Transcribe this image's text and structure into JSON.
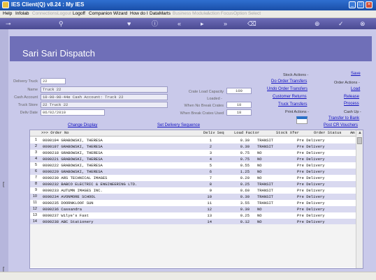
{
  "window": {
    "title": "IES Client(Q) v8.24 : My IES"
  },
  "menu": [
    "Help",
    "Infolab",
    "Connections",
    "Logout",
    "Logoff",
    "Companion",
    "Wizard",
    "How do I",
    "DataMarts",
    "Business Modules",
    "Action Focus",
    "Option Select"
  ],
  "menu_disabled": [
    2,
    3,
    9,
    10,
    11
  ],
  "page": {
    "title": "Sari Sari Dispatch"
  },
  "form": {
    "delivery_truck_label": "Delivery Truck",
    "delivery_truck": "22",
    "name_label": "Name",
    "name": "Truck 22",
    "cash_account_label": "Cash Account",
    "cash_account": "10-00-00-44e Cash Account: Truck 22",
    "truck_store_label": "Truck Store",
    "truck_store": "22 Truck 22",
    "deliv_date_label": "Deliv Date",
    "deliv_date": "06/02/2010",
    "crate_capacity_label": "Crate Load Capacity",
    "crate_capacity": "100",
    "loaded_label": "Loaded -",
    "no_break_label": "When No Break Crates",
    "no_break": "18",
    "break_label": "When Break Crates Used",
    "break": "18"
  },
  "actions": {
    "stock_header": "Stock Actions -",
    "do_order_transfers": "Do Order Transfers",
    "undo_order_transfers": "Undo Order Transfers",
    "customer_returns": "Customer Returns",
    "truck_transfers": "Truck Transfers",
    "print_header": "Print Actions -",
    "save": "Save",
    "order_header": "Order Actions -",
    "load": "Load",
    "release": "Release",
    "process": "Process",
    "cash_header": "Cash Up -",
    "transfer_to_bank": "Transfer to Bank",
    "post_cr_vouchers": "Post CR Vouchers",
    "change_display": "Change Display",
    "set_delivery_sequence": "Set Delivery Sequence"
  },
  "grid": {
    "columns": [
      ">>> Order No",
      "Deliv Seq",
      "Load Factor",
      "Stock Xfer",
      "Order Status",
      "Am"
    ],
    "rows": [
      [
        "1",
        "0000194 GRABOWSKI, THERESA",
        "1",
        "0.30",
        "TRANSIT",
        "Pre Delivery"
      ],
      [
        "2",
        "0000197 GRABOWSKI, THERESA",
        "2",
        "0.30",
        "TRANSIT",
        "Pre Delivery"
      ],
      [
        "3",
        "0000218 GRABOWSKI, THERESA",
        "3",
        "0.75",
        "NO",
        "Pre Delivery"
      ],
      [
        "4",
        "0000221 GRABOWSKI, THERESA",
        "4",
        "0.75",
        "NO",
        "Pre Delivery"
      ],
      [
        "5",
        "0000222 GRABOWSKI, THERESA",
        "5",
        "0.55",
        "NO",
        "Pre Delivery"
      ],
      [
        "6",
        "0000229 GRABOWSKI, THERESA",
        "6",
        "1.25",
        "NO",
        "Pre Delivery"
      ],
      [
        "7",
        "0000230 ARS TECHNICAL IMAGES",
        "7",
        "0.20",
        "NO",
        "Pre Delivery"
      ],
      [
        "8",
        "0000232 BABCO ELECTRIC & ENGINEERING LTD.",
        "8",
        "0.25",
        "TRANSIT",
        "Pre Delivery"
      ],
      [
        "9",
        "0000233 AUTUMN IMAGES INC.",
        "9",
        "0.60",
        "TRANSIT",
        "Pre Delivery"
      ],
      [
        "10",
        "0000234 AVONMORE SCHOOL",
        "10",
        "0.30",
        "TRANSIT",
        "Pre Delivery"
      ],
      [
        "11",
        "0000235 DOORNKLOOF SUN",
        "11",
        "3.55",
        "TRANSIT",
        "Pre Delivery"
      ],
      [
        "12",
        "0000236 Cassandra",
        "12",
        "0.30",
        "NO",
        "Pre Delivery"
      ],
      [
        "13",
        "0000237 Wilye's Fast",
        "13",
        "0.25",
        "NO",
        "Pre Delivery"
      ],
      [
        "14",
        "0000238 ABC Stationery",
        "14",
        "0.12",
        "NO",
        "Pre Delivery"
      ]
    ]
  },
  "colors": {
    "background": "#c9c9ea",
    "banner": "#6f6fb8",
    "toolbar": "#4a4a92",
    "link": "#1010c0",
    "row_alt": "#d9d9f0"
  },
  "icons": [
    "back-icon",
    "search-icon",
    "heart-icon",
    "info-icon",
    "rewind-icon",
    "play-icon",
    "fast-forward-icon",
    "trash-icon",
    "plus-icon",
    "check-icon",
    "close-icon"
  ]
}
